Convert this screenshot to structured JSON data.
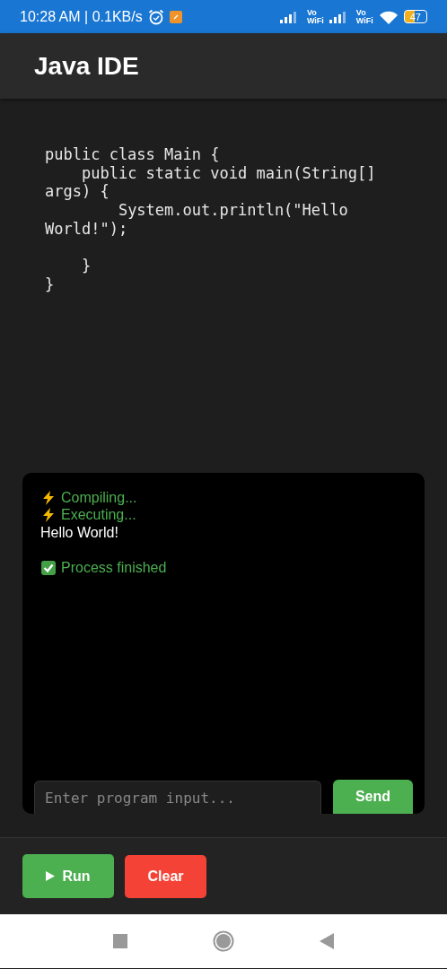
{
  "status_bar": {
    "time": "10:28 AM | 0.1KB/s",
    "vowifi": [
      {
        "top": "Vo",
        "bottom": "WiFi"
      },
      {
        "top": "Vo",
        "bottom": "WiFi"
      }
    ],
    "battery": "47"
  },
  "app_bar": {
    "title": "Java IDE"
  },
  "editor": {
    "code": "public class Main {\n    public static void main(String[] args) {\n        System.out.println(\"Hello World!\");\n\n    }\n}"
  },
  "console": {
    "lines": [
      {
        "kind": "progress",
        "text": "Compiling..."
      },
      {
        "kind": "progress",
        "text": "Executing..."
      },
      {
        "kind": "stdout",
        "text": "Hello World!"
      },
      {
        "kind": "blank"
      },
      {
        "kind": "success",
        "text": "Process finished"
      }
    ],
    "input": {
      "placeholder": "Enter program input..."
    },
    "send_button": "Send"
  },
  "actions": [
    {
      "kind": "run",
      "label": "Run"
    },
    {
      "kind": "clear",
      "label": "Clear"
    }
  ]
}
